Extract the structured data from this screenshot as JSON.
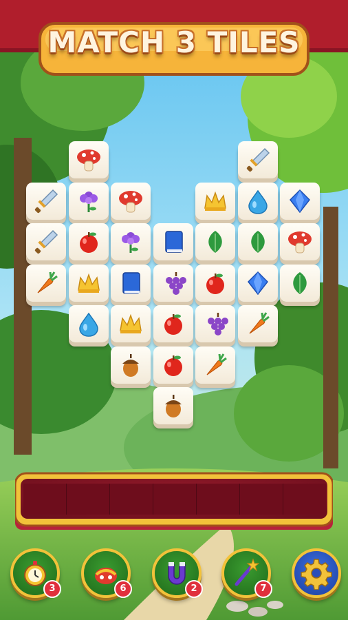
{
  "title": "MATCH 3 TILES",
  "colors": {
    "banner": "#b01e2c",
    "tray": "#8a1626",
    "tray_border": "#f2c23a",
    "tile": "#fffaf0",
    "leaf": "#2e9a3e"
  },
  "board": {
    "rows": [
      [
        "",
        "mushroom",
        "",
        "",
        "",
        "sword",
        ""
      ],
      [
        "sword",
        "flower",
        "mushroom",
        "",
        "crown",
        "drop",
        "gem"
      ],
      [
        "sword",
        "apple",
        "flower",
        "book",
        "leaf",
        "leaf",
        "mushroom"
      ],
      [
        "carrot",
        "crown",
        "book",
        "grapes",
        "apple",
        "gem",
        "leaf"
      ],
      [
        "",
        "drop",
        "crown",
        "apple",
        "grapes",
        "carrot",
        ""
      ],
      [
        "",
        "",
        "acorn",
        "apple",
        "carrot",
        "",
        ""
      ],
      [
        "",
        "",
        "",
        "acorn",
        "",
        "",
        ""
      ]
    ]
  },
  "tray": {
    "slot_count": 7,
    "slots": []
  },
  "powerups": [
    {
      "name": "stopwatch",
      "count": "3"
    },
    {
      "name": "shuffle",
      "count": "6"
    },
    {
      "name": "magnet",
      "count": "2"
    },
    {
      "name": "magic-wand",
      "count": "7"
    }
  ],
  "settings": {
    "icon": "gear-icon"
  }
}
